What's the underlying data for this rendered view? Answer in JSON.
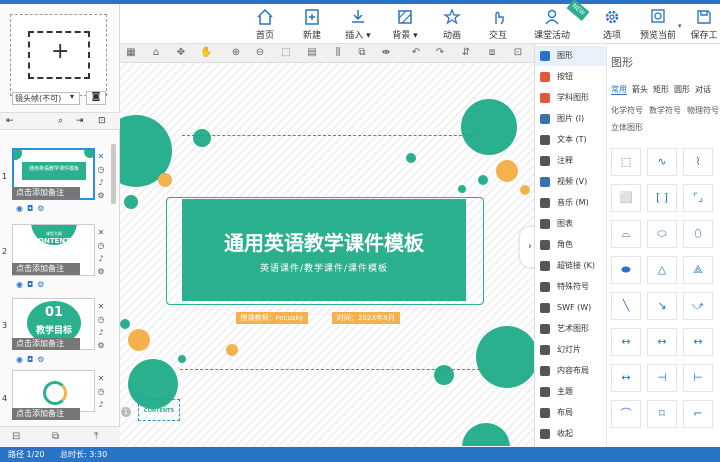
{
  "ribbon": {
    "home": "首页",
    "new": "新建",
    "insert": "插入",
    "background": "背景",
    "animation": "动画",
    "interaction": "交互",
    "class_activity": "课堂活动",
    "new_badge": "NEW",
    "options": "选项",
    "preview": "预览当前",
    "save": "保存工"
  },
  "left_panel": {
    "camera_frame": "镜头帧(不可)",
    "slides": [
      {
        "num": "1",
        "note": "点击添加备注"
      },
      {
        "num": "2",
        "note": "点击添加备注"
      },
      {
        "num": "3",
        "note": "点击添加备注"
      },
      {
        "num": "4",
        "note": "点击添加备注"
      }
    ]
  },
  "thumbs": {
    "t1_title": "通用英语教学课件模板",
    "t2_small": "课程大纲",
    "t2_big": "CONTENTS",
    "t3_num": "01",
    "t3_title": "教学目标"
  },
  "slide": {
    "title": "通用英语教学课件模板",
    "subtitle": "英语课件/教学课件/课件模板",
    "teacher": "授课教师：Focusky",
    "time": "时间：202X年X月",
    "corner_small": "课程大纲",
    "corner_big": "CONTENTS",
    "corner_num": "1"
  },
  "shape_list": [
    "图形",
    "按钮",
    "学科图形",
    "图片 (I)",
    "文本 (T)",
    "注释",
    "视频 (V)",
    "音乐 (M)",
    "图表",
    "角色",
    "超链接 (K)",
    "特殊符号",
    "SWF (W)",
    "艺术图形",
    "幻灯片",
    "内容布局",
    "主题",
    "布局",
    "收起"
  ],
  "shape_panel": {
    "title": "图形",
    "tabs": [
      "常用",
      "箭头",
      "矩形",
      "圆形",
      "对话"
    ],
    "subtabs": [
      "化学符号",
      "数学符号",
      "物理符号",
      "立体图形"
    ]
  },
  "status": {
    "path": "路径 1/20",
    "total_time": "总时长: 3:30"
  },
  "colors": {
    "accent": "#2ab08f",
    "blue": "#2a74c8",
    "orange": "#f4b24e"
  }
}
